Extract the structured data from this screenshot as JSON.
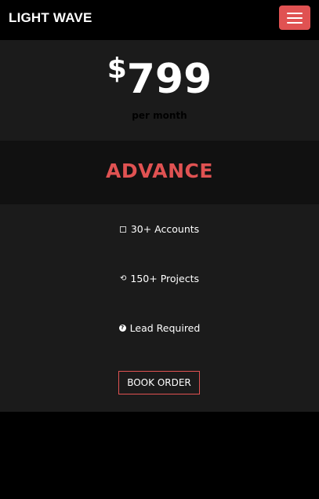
{
  "navbar": {
    "brand": "LIGHT WAVE",
    "menu_icon": "hamburger-menu-icon"
  },
  "colors": {
    "accent": "#e05252",
    "card_bg": "#1b1b1b",
    "header_bg": "#111111",
    "page_bg": "#000000"
  },
  "pricing": {
    "currency": "$",
    "amount": "799",
    "period": "per month",
    "plan": "ADVANCE",
    "features": [
      {
        "icon": "square-icon",
        "label": "30+ Accounts"
      },
      {
        "icon": "refresh-icon",
        "label": "150+ Projects"
      },
      {
        "icon": "question-circle-icon",
        "label": "Lead Required"
      }
    ],
    "button_label": "BOOK ORDER"
  }
}
